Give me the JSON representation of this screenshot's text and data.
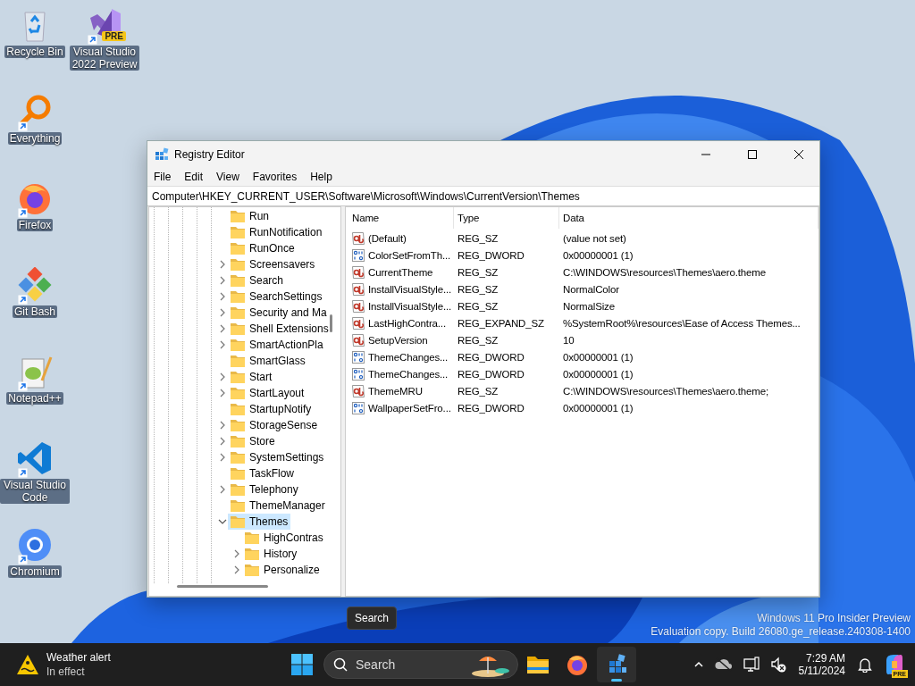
{
  "desktop_icons": [
    {
      "label": "Recycle Bin",
      "kind": "recycle",
      "shortcut": false
    },
    {
      "label": "Visual Studio 2022 Preview",
      "kind": "vs-preview",
      "shortcut": true,
      "badge": "PRE"
    },
    {
      "label": "Everything",
      "kind": "everything",
      "shortcut": true
    },
    {
      "label": "Firefox",
      "kind": "firefox",
      "shortcut": true
    },
    {
      "label": "Git Bash",
      "kind": "gitbash",
      "shortcut": true
    },
    {
      "label": "Notepad++",
      "kind": "notepad",
      "shortcut": true
    },
    {
      "label": "Visual Studio Code",
      "kind": "vscode",
      "shortcut": true
    },
    {
      "label": "Chromium",
      "kind": "chromium",
      "shortcut": true
    }
  ],
  "window": {
    "title": "Registry Editor",
    "menu": [
      "File",
      "Edit",
      "View",
      "Favorites",
      "Help"
    ],
    "address": "Computer\\HKEY_CURRENT_USER\\Software\\Microsoft\\Windows\\CurrentVersion\\Themes",
    "tree": [
      {
        "label": "Run",
        "expandable": false,
        "selected": false
      },
      {
        "label": "RunNotification",
        "expandable": false,
        "selected": false
      },
      {
        "label": "RunOnce",
        "expandable": false,
        "selected": false
      },
      {
        "label": "Screensavers",
        "expandable": true,
        "expanded": false,
        "selected": false
      },
      {
        "label": "Search",
        "expandable": true,
        "expanded": false,
        "selected": false
      },
      {
        "label": "SearchSettings",
        "expandable": true,
        "expanded": false,
        "selected": false
      },
      {
        "label": "Security and Ma",
        "expandable": true,
        "expanded": false,
        "selected": false
      },
      {
        "label": "Shell Extensions",
        "expandable": true,
        "expanded": false,
        "selected": false
      },
      {
        "label": "SmartActionPla",
        "expandable": true,
        "expanded": false,
        "selected": false
      },
      {
        "label": "SmartGlass",
        "expandable": false,
        "selected": false
      },
      {
        "label": "Start",
        "expandable": true,
        "expanded": false,
        "selected": false
      },
      {
        "label": "StartLayout",
        "expandable": true,
        "expanded": false,
        "selected": false
      },
      {
        "label": "StartupNotify",
        "expandable": false,
        "selected": false
      },
      {
        "label": "StorageSense",
        "expandable": true,
        "expanded": false,
        "selected": false
      },
      {
        "label": "Store",
        "expandable": true,
        "expanded": false,
        "selected": false
      },
      {
        "label": "SystemSettings",
        "expandable": true,
        "expanded": false,
        "selected": false
      },
      {
        "label": "TaskFlow",
        "expandable": false,
        "selected": false
      },
      {
        "label": "Telephony",
        "expandable": true,
        "expanded": false,
        "selected": false
      },
      {
        "label": "ThemeManager",
        "expandable": false,
        "selected": false
      },
      {
        "label": "Themes",
        "expandable": true,
        "expanded": true,
        "selected": true,
        "children": [
          {
            "label": "HighContras",
            "expandable": false,
            "selected": false
          },
          {
            "label": "History",
            "expandable": true,
            "expanded": false,
            "selected": false
          },
          {
            "label": "Personalize",
            "expandable": true,
            "expanded": false,
            "selected": false
          }
        ]
      }
    ],
    "columns": [
      "Name",
      "Type",
      "Data"
    ],
    "values": [
      {
        "kind": "string",
        "name": "(Default)",
        "type": "REG_SZ",
        "data": "(value not set)"
      },
      {
        "kind": "binary",
        "name": "ColorSetFromTh...",
        "type": "REG_DWORD",
        "data": "0x00000001 (1)"
      },
      {
        "kind": "string",
        "name": "CurrentTheme",
        "type": "REG_SZ",
        "data": "C:\\WINDOWS\\resources\\Themes\\aero.theme"
      },
      {
        "kind": "string",
        "name": "InstallVisualStyle...",
        "type": "REG_SZ",
        "data": "NormalColor"
      },
      {
        "kind": "string",
        "name": "InstallVisualStyle...",
        "type": "REG_SZ",
        "data": "NormalSize"
      },
      {
        "kind": "string",
        "name": "LastHighContra...",
        "type": "REG_EXPAND_SZ",
        "data": "%SystemRoot%\\resources\\Ease of Access Themes..."
      },
      {
        "kind": "string",
        "name": "SetupVersion",
        "type": "REG_SZ",
        "data": "10"
      },
      {
        "kind": "binary",
        "name": "ThemeChanges...",
        "type": "REG_DWORD",
        "data": "0x00000001 (1)"
      },
      {
        "kind": "binary",
        "name": "ThemeChanges...",
        "type": "REG_DWORD",
        "data": "0x00000001 (1)"
      },
      {
        "kind": "string",
        "name": "ThemeMRU",
        "type": "REG_SZ",
        "data": "C:\\WINDOWS\\resources\\Themes\\aero.theme;"
      },
      {
        "kind": "binary",
        "name": "WallpaperSetFro...",
        "type": "REG_DWORD",
        "data": "0x00000001 (1)"
      }
    ]
  },
  "tooltip": "Search",
  "watermark": [
    "Windows 11 Pro Insider Preview",
    "Evaluation copy. Build 26080.ge_release.240308-1400"
  ],
  "taskbar": {
    "weather": {
      "title": "Weather alert",
      "subtitle": "In effect"
    },
    "search": {
      "placeholder": "Search"
    },
    "apps": [
      {
        "kind": "explorer",
        "active": false
      },
      {
        "kind": "firefox",
        "active": false
      },
      {
        "kind": "regedit",
        "active": true
      }
    ],
    "clock": {
      "time": "7:29 AM",
      "date": "5/11/2024"
    },
    "copilot_badge": "PRE"
  }
}
